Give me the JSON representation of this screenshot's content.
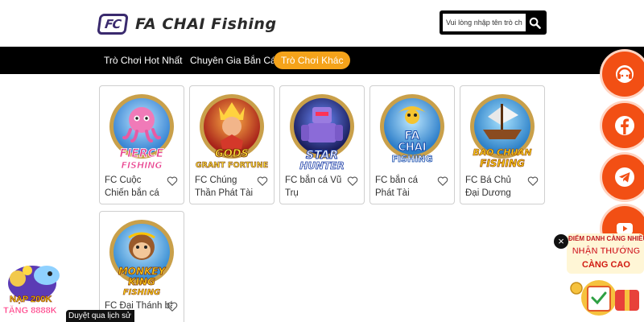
{
  "header": {
    "logo_mark": "FC",
    "logo_text": "FA CHAI Fishing",
    "search_placeholder": "Vui lòng nhập tên trò chơi."
  },
  "nav": {
    "items": [
      {
        "label": "Trò Chơi Hot Nhất",
        "active": false
      },
      {
        "label": "Chuyên Gia Bắn Cá",
        "active": false
      },
      {
        "label": "Trò Chơi Khác",
        "active": true
      }
    ]
  },
  "games": [
    {
      "title": "FC Cuộc Chiến bắn cá",
      "art_text": [
        "FIERCE",
        "FISHING"
      ],
      "art_color": "#e83e8c"
    },
    {
      "title": "FC Chúng Thần Phát Tài",
      "art_text": [
        "GODS",
        "GRANT FORTUNE"
      ],
      "art_color": "#f0b800"
    },
    {
      "title": "FC bắn cá Vũ Trụ",
      "art_text": [
        "STAR",
        "HUNTER"
      ],
      "art_color": "#3d7bff"
    },
    {
      "title": "FC bắn cá Phát Tài",
      "art_text": [
        "FA",
        "CHAI",
        "FISHING"
      ],
      "art_color": "#3b66d6"
    },
    {
      "title": "FC Bá Chủ Đại Dương",
      "art_text": [
        "BAO CHUAN",
        "FISHING"
      ],
      "art_color": "#f0a400"
    },
    {
      "title": "FC Đại Thánh bắ",
      "art_text": [
        "MONKEY",
        "KING",
        "FISHING"
      ],
      "art_color": "#f0b800"
    }
  ],
  "social": [
    "support-chat",
    "facebook",
    "telegram",
    "youtube"
  ],
  "promo_right": {
    "close": "×",
    "line1": "ĐIỂM DANH CÀNG NHIỀU",
    "line2": "NHẬN THƯỞNG",
    "line3": "CÀNG CAO"
  },
  "promo_left": {
    "line1": "NẠP 200K",
    "line2": "TẶNG 8888K"
  },
  "history_label": "Duyệt qua lịch sử",
  "colors": {
    "nav_bg": "#000000",
    "active_tab": "#f5a31a",
    "social_bg": "#f24f14",
    "logo": "#3a2a6e"
  }
}
